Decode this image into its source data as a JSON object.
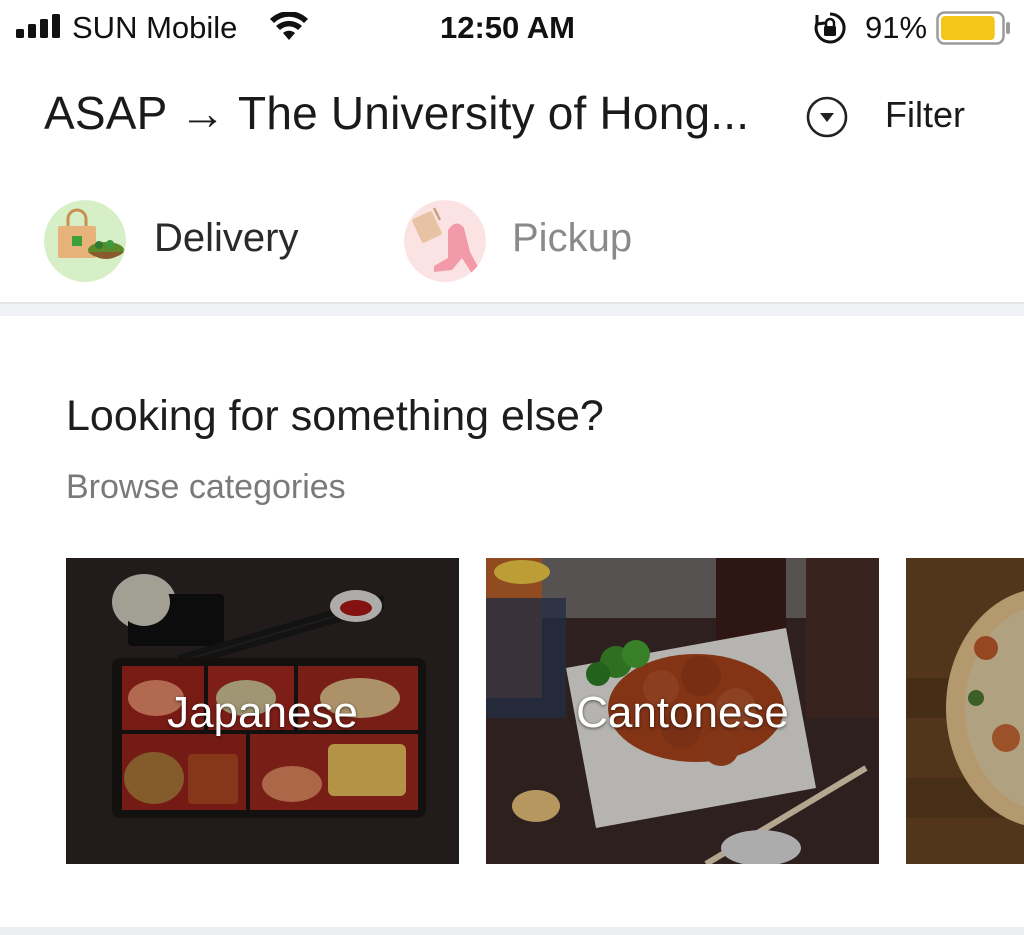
{
  "status_bar": {
    "carrier": "SUN Mobile",
    "time": "12:50 AM",
    "battery_percent": "91%",
    "battery_level": 0.91,
    "icons": [
      "signal-icon",
      "wifi-icon",
      "orientation-lock-icon",
      "battery-icon"
    ]
  },
  "top_nav": {
    "location": "ASAP → The University of Hong...",
    "location_caret_icon": "chevron-down-circle-icon",
    "filter_label": "Filter"
  },
  "modes": [
    {
      "label": "Delivery",
      "icon": "delivery-bag-icon",
      "selected": true
    },
    {
      "label": "Pickup",
      "icon": "pickup-walker-icon",
      "selected": false
    }
  ],
  "categories_section": {
    "title": "Looking for something else?",
    "subtitle": "Browse categories",
    "cards": [
      {
        "label": "Japanese",
        "image": "japanese-bento-image"
      },
      {
        "label": "Cantonese",
        "image": "cantonese-dish-image"
      },
      {
        "label": "",
        "image": "pizza-image"
      }
    ]
  },
  "colors": {
    "battery_fill": "#f5c518",
    "delivery_icon_bg": "#d6efc6",
    "pickup_icon_bg": "#fbe3e3",
    "divider": "#f1f2f5"
  }
}
